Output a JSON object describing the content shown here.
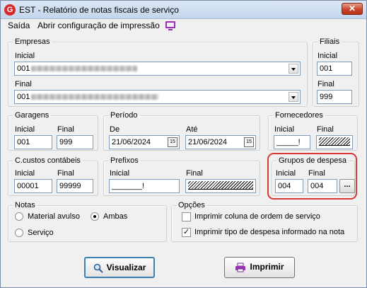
{
  "window": {
    "title": "EST - Relatório de notas fiscais de serviço",
    "app_icon_letter": "G",
    "close_glyph": "✕"
  },
  "menu": {
    "items": [
      "Saída",
      "Abrir configuração de impressão"
    ]
  },
  "empresas": {
    "legend": "Empresas",
    "inicial_label": "Inicial",
    "inicial_value": "001",
    "final_label": "Final",
    "final_value": "001"
  },
  "filiais": {
    "legend": "Filiais",
    "inicial_label": "Inicial",
    "inicial_value": "001",
    "final_label": "Final",
    "final_value": "999"
  },
  "garagens": {
    "legend": "Garagens",
    "inicial_label": "Inicial",
    "inicial_value": "001",
    "final_label": "Final",
    "final_value": "999"
  },
  "periodo": {
    "legend": "Período",
    "de_label": "De",
    "de_value": "21/06/2024",
    "ate_label": "Até",
    "ate_value": "21/06/2024",
    "cal_glyph": "15"
  },
  "fornecedores": {
    "legend": "Fornecedores",
    "inicial_label": "Inicial",
    "inicial_value": "_____!",
    "final_label": "Final"
  },
  "custos": {
    "legend": "C.custos contábeis",
    "inicial_label": "Inicial",
    "inicial_value": "00001",
    "final_label": "Final",
    "final_value": "99999"
  },
  "prefixos": {
    "legend": "Prefixos",
    "inicial_label": "Inicial",
    "inicial_value": "_______!",
    "final_label": "Final"
  },
  "grupos": {
    "legend": "Grupos de despesa",
    "inicial_label": "Inicial",
    "inicial_value": "004",
    "final_label": "Final",
    "final_value": "004",
    "lookup_label": "..."
  },
  "notas": {
    "legend": "Notas",
    "options": [
      "Material avulso",
      "Ambas",
      "Serviço"
    ],
    "selected": "Ambas"
  },
  "opcoes": {
    "legend": "Opções",
    "items": [
      {
        "label": "Imprimir coluna de ordem de serviço",
        "checked": false
      },
      {
        "label": "Imprimir tipo de despesa informado na nota",
        "checked": true
      }
    ]
  },
  "buttons": {
    "visualizar": "Visualizar",
    "imprimir": "Imprimir"
  },
  "colors": {
    "highlight": "#d63a35",
    "accent": "#9a2fb5",
    "close": "#c8462b"
  }
}
